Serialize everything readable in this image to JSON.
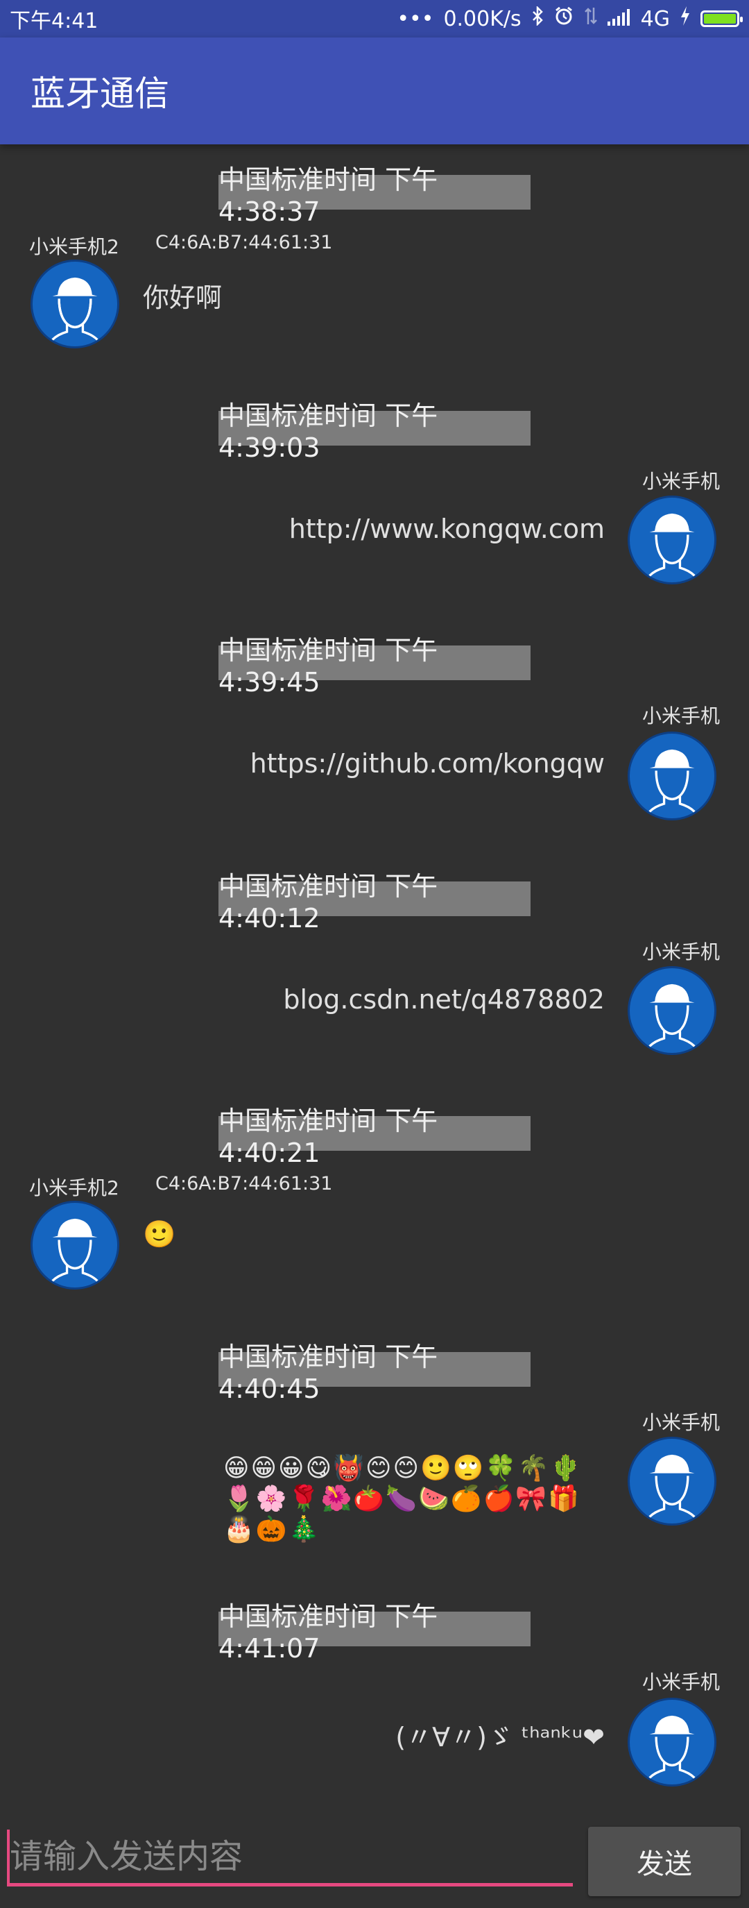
{
  "status": {
    "time": "下午4:41",
    "dots": "•••",
    "speed": "0.00K/s",
    "network": "4G",
    "icons": [
      "bluetooth-icon",
      "alarm-icon",
      "data-icon",
      "signal-icon",
      "charging-icon",
      "battery-icon"
    ],
    "bg_color": "#3548a3",
    "battery_color": "#7fe11f"
  },
  "appbar": {
    "title": "蓝牙通信",
    "bg_color": "#3f51b5"
  },
  "messages": [
    {
      "time": "中国标准时间 下午4:38:37",
      "side": "left",
      "name": "小米手机2",
      "mac": "C4:6A:B7:44:61:31",
      "text": "你好啊"
    },
    {
      "time": "中国标准时间 下午4:39:03",
      "side": "right",
      "name": "小米手机",
      "text": "http://www.kongqw.com"
    },
    {
      "time": "中国标准时间 下午4:39:45",
      "side": "right",
      "name": "小米手机",
      "text": "https://github.com/kongqw"
    },
    {
      "time": "中国标准时间 下午4:40:12",
      "side": "right",
      "name": "小米手机",
      "text": "blog.csdn.net/q4878802"
    },
    {
      "time": "中国标准时间 下午4:40:21",
      "side": "left",
      "name": "小米手机2",
      "mac": "C4:6A:B7:44:61:31",
      "text": "🙂"
    },
    {
      "time": "中国标准时间 下午4:40:45",
      "side": "right",
      "name": "小米手机",
      "text": "😁😁😀😋👹😊😊🙂🙄🍀🌴🌵🌷🌸🌹🌺🍅🍆🍉🍊🍎🎀🎁🎂🎃🎄"
    },
    {
      "time": "中国标准时间 下午4:41:07",
      "side": "right",
      "name": "小米手机",
      "text": "(〃∀〃)ゞ ᵗʰᵃⁿᵏᵘ❤"
    }
  ],
  "input": {
    "placeholder": "请输入发送内容",
    "value": ""
  },
  "send_button": {
    "label": "发送"
  },
  "colors": {
    "background": "#303030",
    "timestamp_bg": "#7c7c7c",
    "avatar": "#1565c0",
    "input_accent": "#e64980"
  }
}
